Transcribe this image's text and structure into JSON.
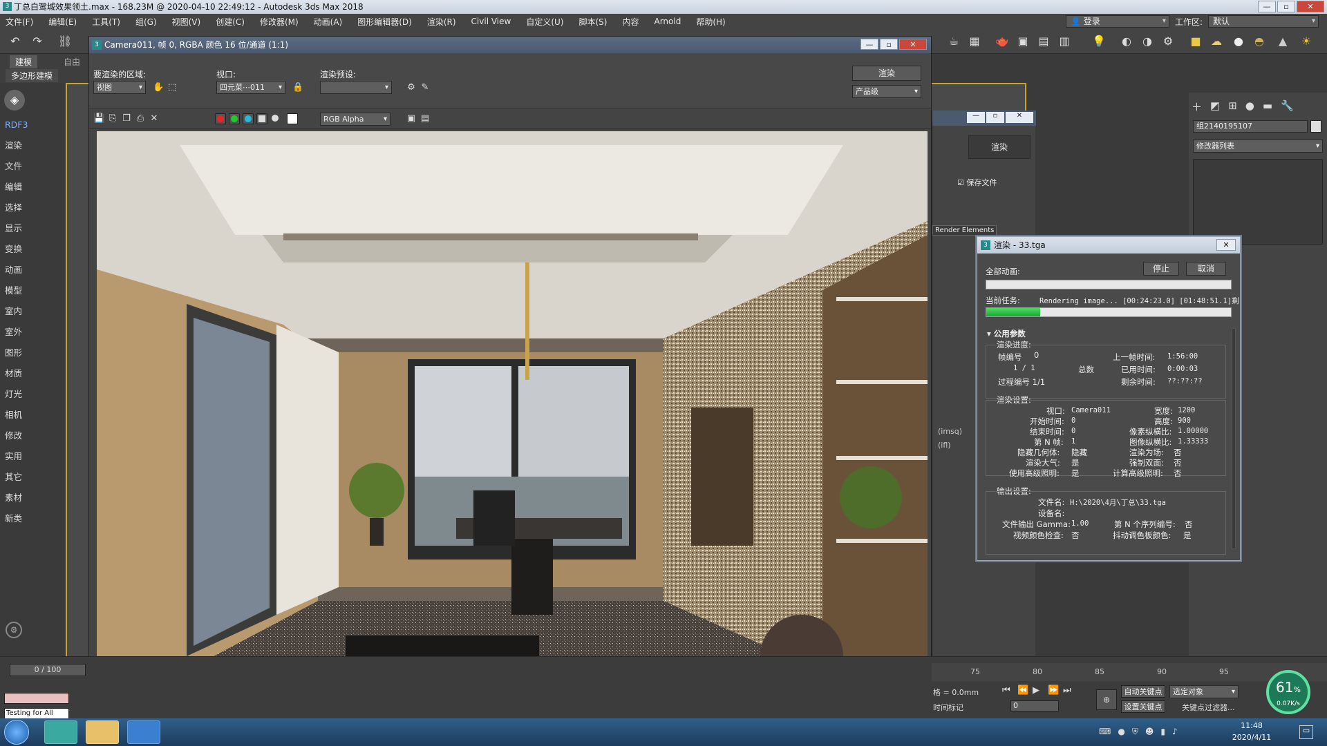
{
  "title_bar": {
    "text": "丁总白鹭城效果领土.max - 168.23M @ 2020-04-10 22:49:12 - Autodesk 3ds Max 2018",
    "app_icon": "3"
  },
  "menu": {
    "items": [
      "文件(F)",
      "编辑(E)",
      "工具(T)",
      "组(G)",
      "视图(V)",
      "创建(C)",
      "修改器(M)",
      "动画(A)",
      "图形编辑器(D)",
      "渲染(R)",
      "Civil View",
      "自定义(U)",
      "脚本(S)",
      "内容",
      "Arnold",
      "帮助(H)"
    ],
    "login": "登录",
    "workspace_label": "工作区:",
    "workspace_value": "默认"
  },
  "ribbon": {
    "tab1": "建模",
    "tab2": "自由",
    "sub": "多边形建模"
  },
  "left_panel": {
    "logo": "◈",
    "items": [
      "RDF3",
      "渲染",
      "文件",
      "编辑",
      "选择",
      "显示",
      "变换",
      "动画",
      "模型",
      "室内",
      "室外",
      "图形",
      "材质",
      "灯光",
      "相机",
      "修改",
      "实用",
      "其它",
      "素材",
      "新类"
    ]
  },
  "render_window": {
    "title": "Camera011, 帧 0, RGBA 颜色 16 位/通道 (1:1)",
    "area_label": "要渲染的区域:",
    "area_value": "视图",
    "viewport_label": "视口:",
    "viewport_value": "四元菜⋯011",
    "preset_label": "渲染预设:",
    "preset_value": "",
    "render_button": "渲染",
    "quality_value": "产品级",
    "channel_value": "RGB Alpha"
  },
  "render_setup": {
    "render_button": "渲染",
    "save_file": "保存文件",
    "render_elements": "Render Elements",
    "imsq": "(imsq)",
    "ifl": "(ifl)"
  },
  "right_panel": {
    "object_name": "组2140195107",
    "modifier_list": "修改器列表"
  },
  "progress_dialog": {
    "title": "渲染 - 33.tga",
    "all_anim_label": "全部动画:",
    "stop_button": "停止",
    "cancel_button": "取消",
    "current_task_label": "当前任务:",
    "current_task_value": "Rendering image... [00:24:23.0] [01:48:51.1]剩",
    "current_progress": 0.22,
    "all_progress": 0.0,
    "section_title": "公用参数",
    "progress_group": "渲染进度:",
    "frame_no_label": "帧编号",
    "frame_no_value": "0",
    "frame_count": "1 / 1",
    "total_label": "总数",
    "pass_label": "过程编号 1/1",
    "last_frame_label": "上一帧时间:",
    "last_frame_value": "1:56:00",
    "elapsed_label": "已用时间:",
    "elapsed_value": "0:00:03",
    "remaining_label": "剩余时间:",
    "remaining_value": "??:??:??",
    "settings_group": "渲染设置:",
    "viewport_label": "视口:",
    "viewport_value": "Camera011",
    "width_label": "宽度:",
    "width_value": "1200",
    "start_label": "开始时间:",
    "start_value": "0",
    "height_label": "高度:",
    "height_value": "900",
    "end_label": "结束时间:",
    "end_value": "0",
    "pixel_aspect_label": "像素纵横比:",
    "pixel_aspect_value": "1.00000",
    "nth_label": "第 N 帧:",
    "nth_value": "1",
    "image_aspect_label": "图像纵横比:",
    "image_aspect_value": "1.33333",
    "hidden_label": "隐藏几何体:",
    "hidden_value": "隐藏",
    "field_label": "渲染为场:",
    "field_value": "否",
    "atmos_label": "渲染大气:",
    "atmos_value": "是",
    "twoside_label": "强制双面:",
    "twoside_value": "否",
    "adv_label": "使用高级照明:",
    "adv_value": "是",
    "calc_adv_label": "计算高级照明:",
    "calc_adv_value": "否",
    "output_group": "输出设置:",
    "filename_label": "文件名:",
    "filename_value": "H:\\2020\\4月\\丁总\\33.tga",
    "device_label": "设备名:",
    "device_value": "",
    "gamma_label": "文件输出 Gamma:",
    "gamma_value": "1.00",
    "nth_seq_label": "第 N 个序列编号:",
    "nth_seq_value": "否",
    "video_check_label": "视频颜色检查:",
    "video_check_value": "否",
    "dither_label": "抖动调色板颜色:",
    "dither_value": "是"
  },
  "timeline": {
    "ticks": [
      "75",
      "80",
      "85",
      "90",
      "95"
    ],
    "frame_counter": "0 / 100"
  },
  "status": {
    "testing": "Testing for All",
    "auto_key": "自动关键点",
    "set_key": "设置关键点",
    "selected": "选定对象",
    "key_filter": "关键点过滤器...",
    "grid": "格 = 0.0mm",
    "time_tag": "时间标记",
    "frame_field": "0"
  },
  "perf_widget": {
    "percent": "61",
    "percent_sign": "%",
    "speed": "0.07K/s"
  },
  "taskbar": {
    "time": "11:48",
    "date": "2020/4/11"
  }
}
